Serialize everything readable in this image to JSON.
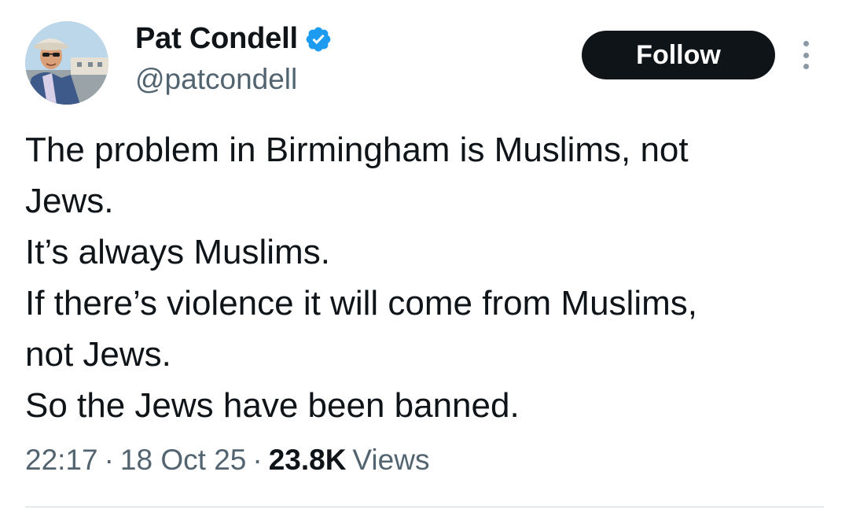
{
  "author": {
    "display_name": "Pat Condell",
    "handle": "@patcondell",
    "verified": true,
    "verified_icon": "verified-badge-icon",
    "verified_color": "#1d9bf0"
  },
  "actions": {
    "follow_label": "Follow",
    "more_icon": "more-vertical-icon"
  },
  "tweet": {
    "lines": [
      "The problem in Birmingham is Muslims, not",
      "Jews.",
      "It’s always Muslims.",
      "If there’s violence it will come from Muslims,",
      "not Jews.",
      "So the Jews have been banned."
    ]
  },
  "meta": {
    "time": "22:17",
    "separator": "·",
    "date": "18 Oct 25",
    "views_count": "23.8K",
    "views_label": "Views"
  },
  "colors": {
    "text_primary": "#0f1419",
    "text_secondary": "#536471",
    "follow_bg": "#0f1419",
    "divider": "#cfd9de"
  }
}
